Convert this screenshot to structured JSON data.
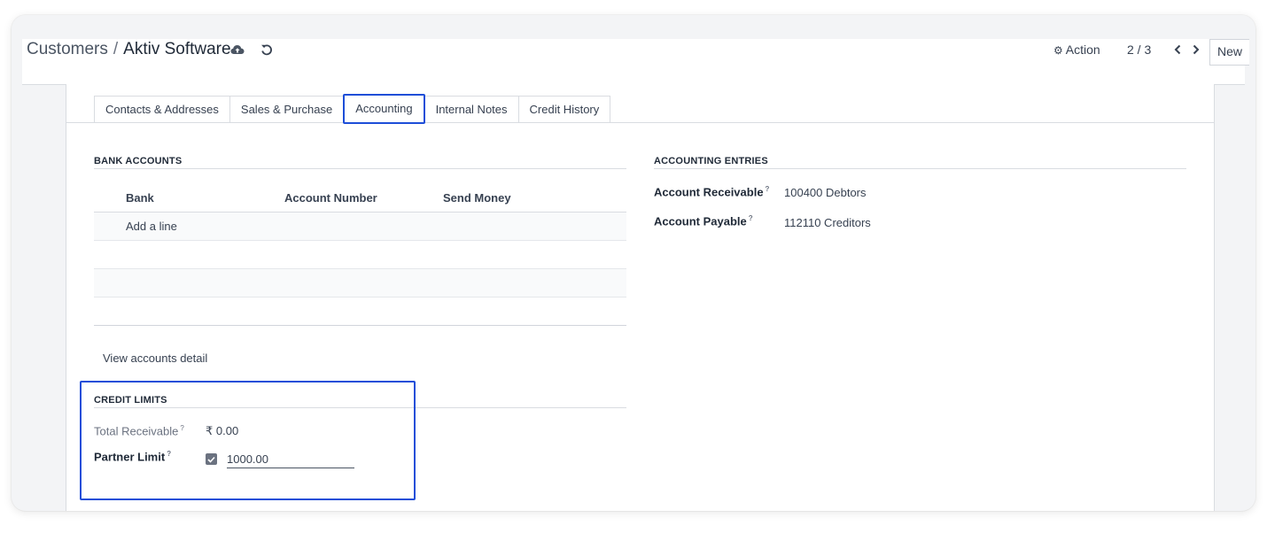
{
  "header": {
    "breadcrumb_parent": "Customers",
    "breadcrumb_sep": "/",
    "breadcrumb_current": "Aktiv Software",
    "save_icon": "cloud-upload-icon",
    "discard_icon": "undo-icon",
    "action_label": "Action",
    "pager": "2 / 3",
    "new_label": "New"
  },
  "tabs": [
    {
      "label": "Contacts & Addresses"
    },
    {
      "label": "Sales & Purchase"
    },
    {
      "label": "Accounting"
    },
    {
      "label": "Internal Notes"
    },
    {
      "label": "Credit History"
    }
  ],
  "bank_accounts": {
    "title": "BANK ACCOUNTS",
    "columns": [
      "Bank",
      "Account Number",
      "Send Money"
    ],
    "add_line": "Add a line",
    "view_detail": "View accounts detail"
  },
  "accounting_entries": {
    "title": "ACCOUNTING ENTRIES",
    "receivable_label": "Account Receivable",
    "receivable_value": "100400 Debtors",
    "payable_label": "Account Payable",
    "payable_value": "112110 Creditors",
    "help_mark": "?"
  },
  "credit_limits": {
    "title": "CREDIT LIMITS",
    "total_receivable_label": "Total Receivable",
    "total_receivable_value": "₹ 0.00",
    "partner_limit_label": "Partner Limit",
    "partner_limit_checked": true,
    "partner_limit_value": "1000.00",
    "help_mark": "?"
  },
  "colors": {
    "highlight": "#1d4ed8"
  }
}
